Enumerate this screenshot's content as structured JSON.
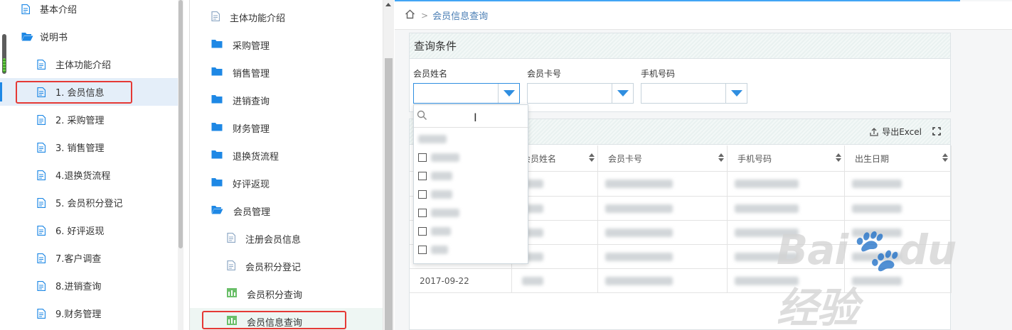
{
  "help_panel": {
    "items": [
      {
        "label": "基本介绍",
        "level": 0,
        "icon": "document-icon"
      },
      {
        "label": "说明书",
        "level": 0,
        "icon": "folder-open-icon"
      },
      {
        "label": "主体功能介绍",
        "level": 1,
        "icon": "document-icon"
      },
      {
        "label": "1. 会员信息",
        "level": 1,
        "icon": "document-icon",
        "active": true
      },
      {
        "label": "2. 采购管理",
        "level": 1,
        "icon": "document-icon"
      },
      {
        "label": "3. 销售管理",
        "level": 1,
        "icon": "document-icon"
      },
      {
        "label": "4.退换货流程",
        "level": 1,
        "icon": "document-icon"
      },
      {
        "label": "5. 会员积分登记",
        "level": 1,
        "icon": "document-icon"
      },
      {
        "label": "6. 好评返现",
        "level": 1,
        "icon": "document-icon"
      },
      {
        "label": "7.客户调查",
        "level": 1,
        "icon": "document-icon"
      },
      {
        "label": "8.进销查询",
        "level": 1,
        "icon": "document-icon"
      },
      {
        "label": "9.财务管理",
        "level": 1,
        "icon": "document-icon"
      }
    ]
  },
  "nav_panel": {
    "items": [
      {
        "label": "主体功能介绍",
        "level": 0,
        "icon": "document-icon"
      },
      {
        "label": "采购管理",
        "level": 0,
        "icon": "folder-icon"
      },
      {
        "label": "销售管理",
        "level": 0,
        "icon": "folder-icon"
      },
      {
        "label": "进销查询",
        "level": 0,
        "icon": "folder-icon"
      },
      {
        "label": "财务管理",
        "level": 0,
        "icon": "folder-icon"
      },
      {
        "label": "退换货流程",
        "level": 0,
        "icon": "folder-icon"
      },
      {
        "label": "好评返现",
        "level": 0,
        "icon": "folder-icon"
      },
      {
        "label": "会员管理",
        "level": 0,
        "icon": "folder-open-icon"
      },
      {
        "label": "注册会员信息",
        "level": 1,
        "icon": "document-icon"
      },
      {
        "label": "会员积分登记",
        "level": 1,
        "icon": "document-icon"
      },
      {
        "label": "会员积分查询",
        "level": 1,
        "icon": "chart-icon"
      },
      {
        "label": "会员信息查询",
        "level": 1,
        "icon": "chart-icon",
        "active": true
      }
    ]
  },
  "breadcrumb": {
    "current": "会员信息查询"
  },
  "query": {
    "title": "查询条件",
    "fields": [
      {
        "label": "会员姓名",
        "value": ""
      },
      {
        "label": "会员卡号",
        "value": ""
      },
      {
        "label": "手机号码",
        "value": ""
      }
    ]
  },
  "table": {
    "export_label": "导出Excel",
    "columns": [
      "会员姓名",
      "会员卡号",
      "手机号码",
      "出生日期"
    ],
    "visible_cells": {
      "last_row_first_col": "2017-09-22"
    }
  },
  "colors": {
    "accent": "#2f8ee0",
    "highlight_red": "#e53935",
    "active_bg": "#e4eef9"
  }
}
